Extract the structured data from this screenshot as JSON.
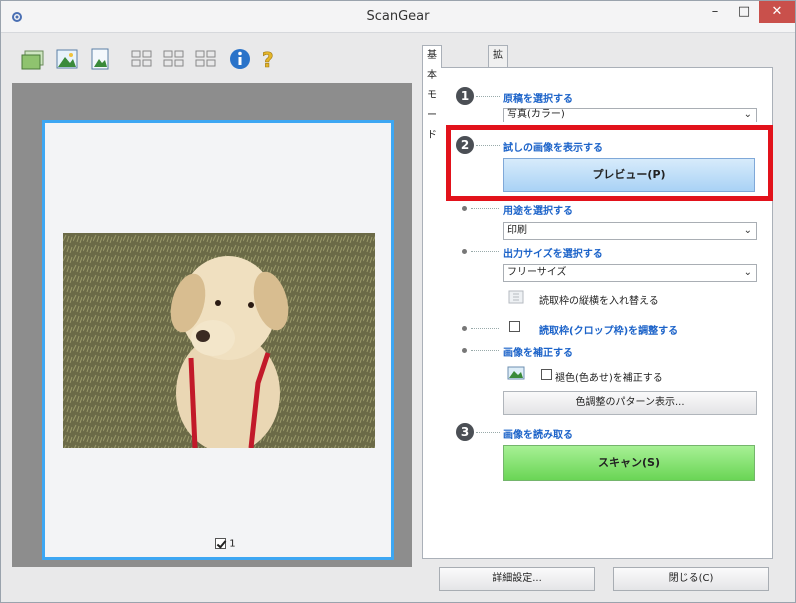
{
  "window": {
    "title": "ScanGear",
    "minimize_glyph": "–",
    "maximize_glyph": "□",
    "close_glyph": "✕"
  },
  "toolbar": {
    "icons": [
      "open-image-icon",
      "photo-icon",
      "document-icon",
      "thumbnail-grid-icon",
      "thumbnail-grid-icon",
      "thumbnail-grid-icon",
      "info-icon",
      "help-icon"
    ]
  },
  "preview": {
    "frame_number": "1",
    "frame_checked": true
  },
  "tabs": [
    {
      "label": "基本モード",
      "active": true
    },
    {
      "label": "拡張モード",
      "active": false
    }
  ],
  "steps": {
    "step1": {
      "number": "1",
      "title": "原稿を選択する",
      "selected": "写真(カラー)"
    },
    "step2": {
      "number": "2",
      "title": "試しの画像を表示する",
      "preview_button": "プレビュー(P)"
    },
    "purpose": {
      "title": "用途を選択する",
      "selected": "印刷"
    },
    "output_size": {
      "title": "出力サイズを選択する",
      "selected": "フリーサイズ",
      "swap_label": "読取枠の縦横を入れ替える"
    },
    "crop": {
      "label": "読取枠(クロップ枠)を調整する",
      "checked": false
    },
    "correct": {
      "title": "画像を補正する",
      "fade_label": "褪色(色あせ)を補正する",
      "fade_checked": false,
      "pattern_button": "色調整のパターン表示..."
    },
    "step3": {
      "number": "3",
      "title": "画像を読み取る",
      "scan_button": "スキャン(S)"
    }
  },
  "footer": {
    "settings_button": "詳細設定...",
    "close_button": "閉じる(C)"
  },
  "colors": {
    "accent_blue": "#1c63c9",
    "highlight_red": "#e2121b",
    "frame_blue": "#3da7f3",
    "scan_green": "#6ad555"
  }
}
